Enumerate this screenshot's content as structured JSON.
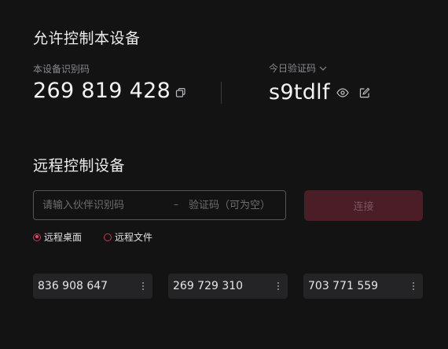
{
  "allow_section": {
    "title": "允许控制本设备",
    "device_id_label": "本设备识别码",
    "device_id": "269 819 428",
    "code_label": "今日验证码",
    "code": "s9tdlf"
  },
  "remote_section": {
    "title": "远程控制设备",
    "id_placeholder": "请输入伙伴识别码",
    "separator": "–",
    "code_placeholder": "验证码（可为空）",
    "connect_label": "连接",
    "modes": [
      {
        "label": "远程桌面",
        "selected": true
      },
      {
        "label": "远程文件",
        "selected": false
      }
    ]
  },
  "recent_devices": [
    {
      "id": "836 908 647"
    },
    {
      "id": "269 729 310"
    },
    {
      "id": "703 771 559"
    }
  ],
  "colors": {
    "background": "#131314",
    "accent": "#c93553",
    "connect_disabled_bg": "#4a1d27",
    "card_bg": "#242426"
  }
}
